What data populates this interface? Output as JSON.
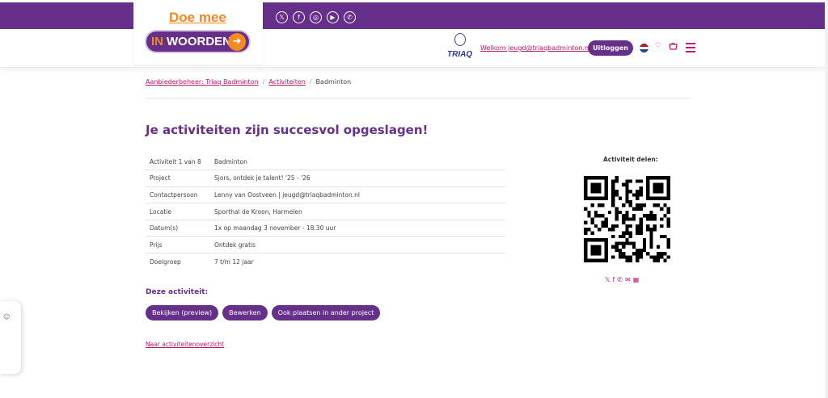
{
  "brand": {
    "tagline": "Doe mee",
    "campaign_in": "IN",
    "campaign_word": "WOORDEN",
    "club_logo_text": "TRIAQ"
  },
  "socials": [
    {
      "icon": "x-icon",
      "glyph": "𝕏"
    },
    {
      "icon": "facebook-icon",
      "glyph": "f"
    },
    {
      "icon": "instagram-icon",
      "glyph": "◎"
    },
    {
      "icon": "youtube-icon",
      "glyph": "▶"
    },
    {
      "icon": "whatsapp-icon",
      "glyph": "✆"
    }
  ],
  "header": {
    "welcome": "Welkom jeugd@triaqbadminton.nl",
    "logout": "Uitloggen"
  },
  "breadcrumb": {
    "item1": "Aanbiederbeheer: Triaq Badminton",
    "item2": "Activiteiten",
    "current": "Badminton",
    "separator": "/"
  },
  "main": {
    "title": "Je activiteiten zijn succesvol opgeslagen!",
    "details": [
      {
        "label": "Activiteit 1 van 8",
        "value": "Badminton"
      },
      {
        "label": "Project",
        "value": "Sjors, ontdek je talent! '25 - '26"
      },
      {
        "label": "Contactpersoon",
        "value": "Lenny van Oostveen | jeugd@triaqbadminton.nl"
      },
      {
        "label": "Locatie",
        "value": "Sporthal de Kroon, Harmelen"
      },
      {
        "label": "Datum(s)",
        "value": "1x op maandag 3 november - 18.30 uur"
      },
      {
        "label": "Prijs",
        "value": "Ontdek gratis"
      },
      {
        "label": "Doelgroep",
        "value": "7 t/m 12 jaar"
      }
    ],
    "share_label": "Activiteit delen:",
    "actions_label": "Deze activiteit:",
    "btn_preview": "Bekijken (preview)",
    "btn_edit": "Bewerken",
    "btn_other_project": "Ook plaatsen in ander project",
    "overview_link": "Naar activiteitenoverzicht"
  },
  "colors": {
    "brand_purple": "#66308a",
    "accent_pink": "#c0176a",
    "accent_orange": "#f08a24"
  }
}
